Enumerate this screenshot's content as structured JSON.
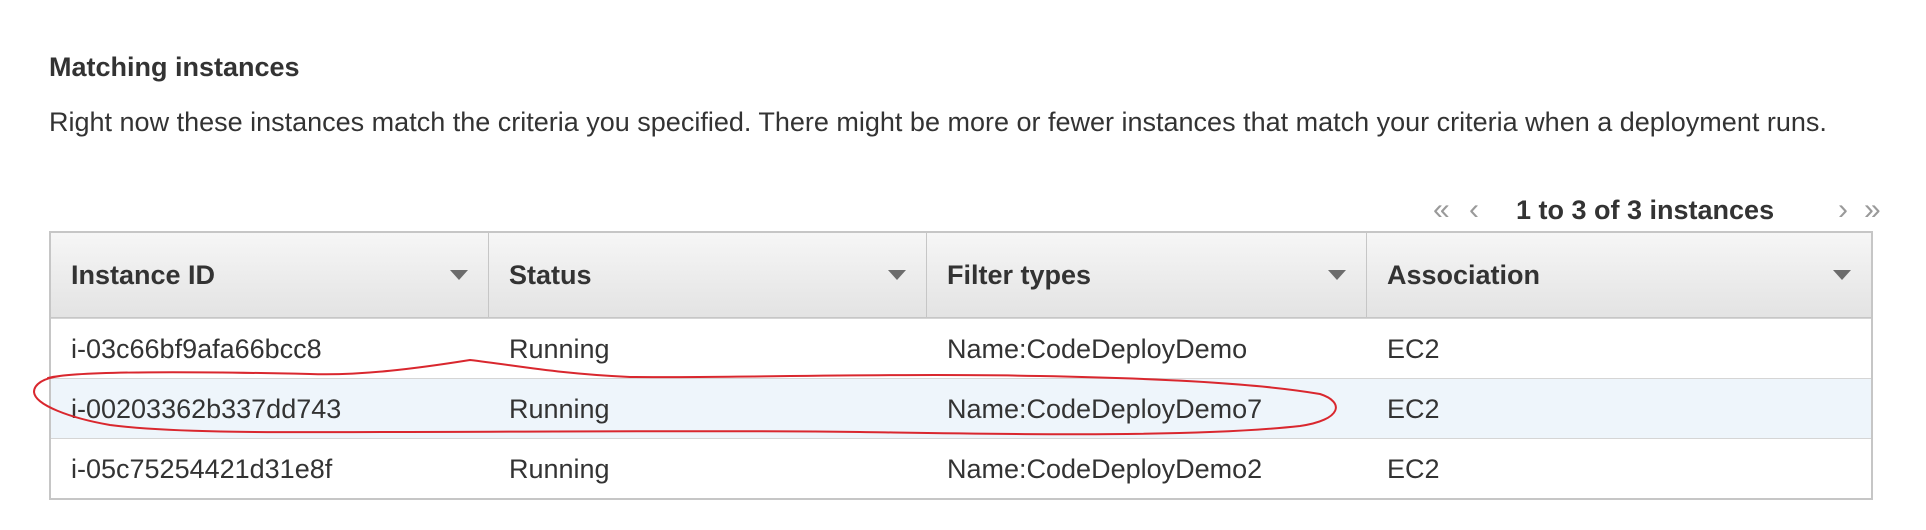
{
  "section": {
    "title": "Matching instances",
    "description": "Right now these instances match the criteria you specified. There might be more or fewer instances that match your criteria when a deployment runs."
  },
  "pagination": {
    "first_icon": "«",
    "prev_icon": "‹",
    "next_icon": "›",
    "last_icon": "»",
    "summary": "1 to 3 of 3 instances"
  },
  "table": {
    "columns": [
      "Instance ID",
      "Status",
      "Filter types",
      "Association"
    ],
    "rows": [
      {
        "instance_id": "i-03c66bf9afa66bcc8",
        "status": "Running",
        "filter_type": "Name:CodeDeployDemo",
        "association": "EC2"
      },
      {
        "instance_id": "i-00203362b337dd743",
        "status": "Running",
        "filter_type": "Name:CodeDeployDemo7",
        "association": "EC2"
      },
      {
        "instance_id": "i-05c75254421d31e8f",
        "status": "Running",
        "filter_type": "Name:CodeDeployDemo2",
        "association": "EC2"
      }
    ],
    "highlighted_row": 1
  },
  "colors": {
    "annotation": "#d9272e",
    "selected_row": "#eef5fb",
    "header_gradient_top": "#f6f6f6",
    "header_gradient_bottom": "#e3e3e3",
    "border": "#c6c6c6"
  },
  "icons": {
    "sort": "triangle-down-icon",
    "pager": [
      "double-chevron-left-icon",
      "chevron-left-icon",
      "chevron-right-icon",
      "double-chevron-right-icon"
    ]
  }
}
